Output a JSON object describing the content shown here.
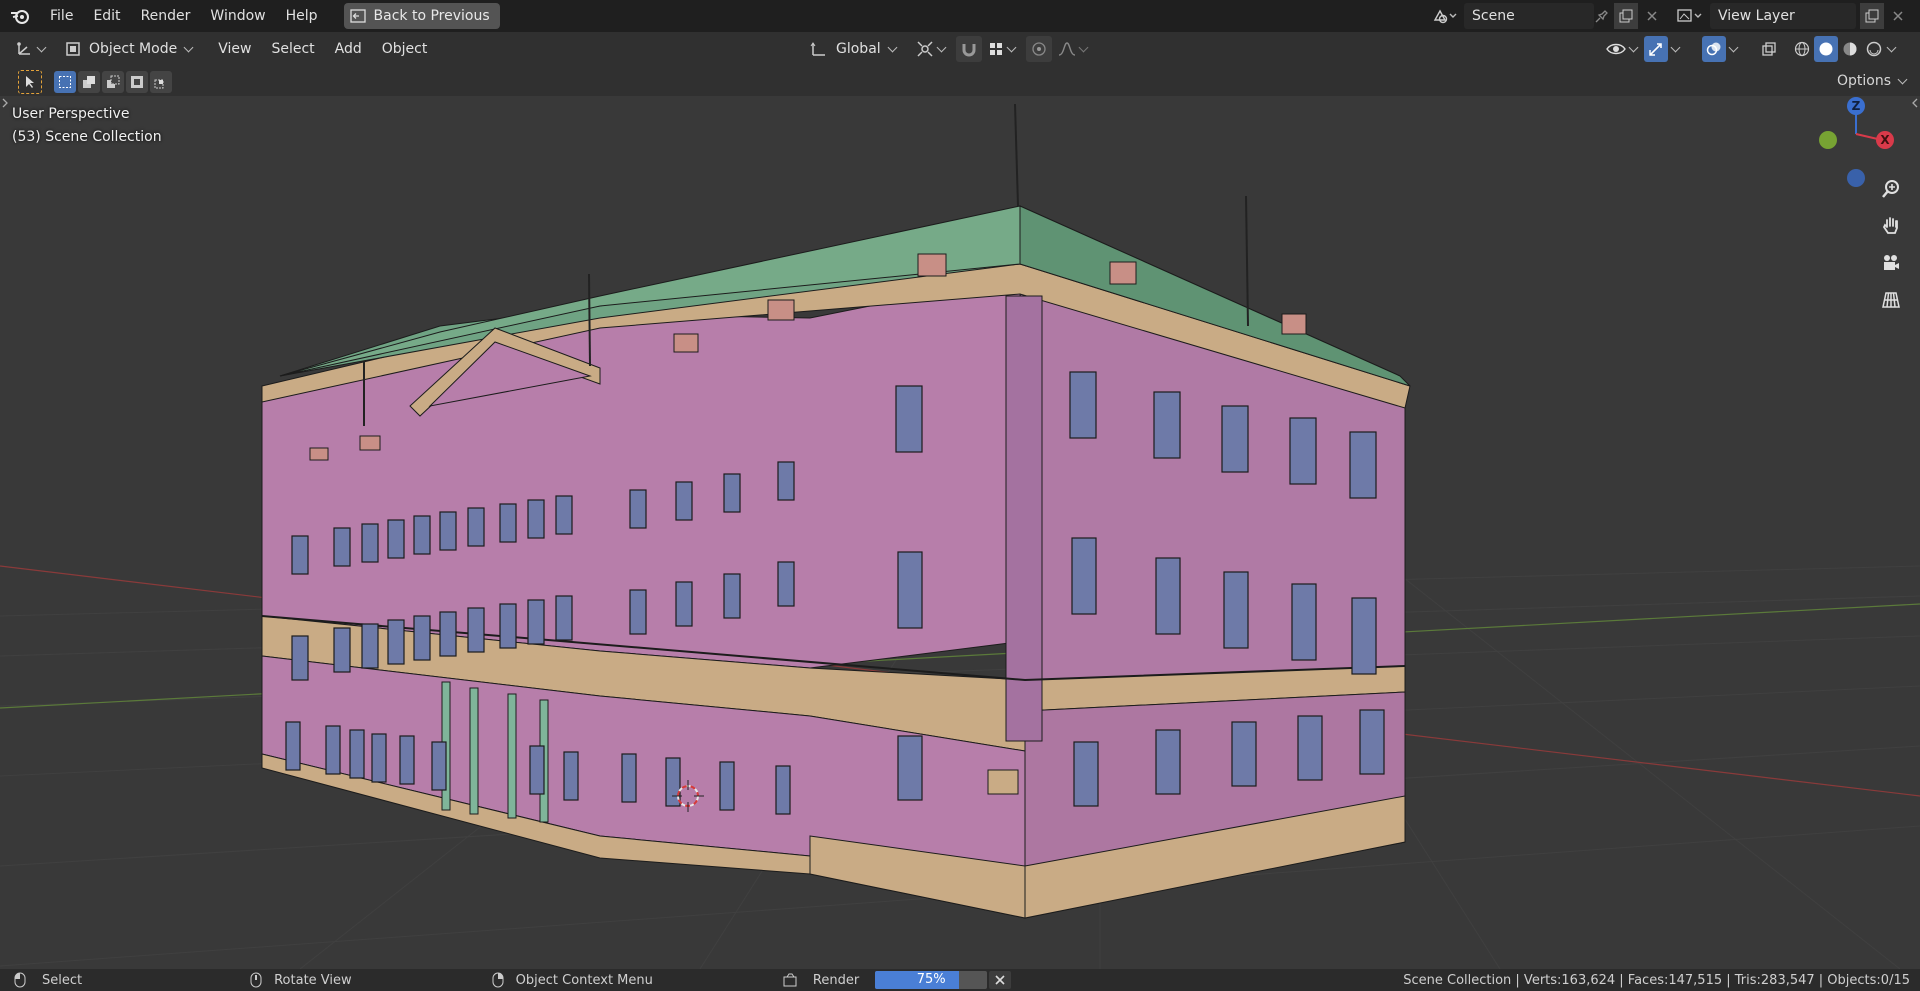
{
  "topbar": {
    "menus": [
      "File",
      "Edit",
      "Render",
      "Window",
      "Help"
    ],
    "back_label": "Back to Previous",
    "scene_name": "Scene",
    "view_layer_name": "View Layer"
  },
  "header": {
    "mode": "Object Mode",
    "menus": [
      "View",
      "Select",
      "Add",
      "Object"
    ],
    "orientation": "Global",
    "options_label": "Options"
  },
  "viewport": {
    "perspective_label": "User Perspective",
    "collection_label": "(53) Scene Collection",
    "gizmo": {
      "z": "Z",
      "x": "X"
    }
  },
  "statusbar": {
    "select": "Select",
    "rotate": "Rotate View",
    "context": "Object Context Menu",
    "render_label": "Render",
    "render_progress": "75%",
    "render_fraction": 0.75,
    "stats": "Scene Collection | Verts:163,624 | Faces:147,515 | Tris:283,547 | Objects:0/15"
  },
  "colors": {
    "accent": "#4772b3",
    "wall": "#b77eaa",
    "roof": "#6fa383",
    "base": "#c9ab85"
  }
}
